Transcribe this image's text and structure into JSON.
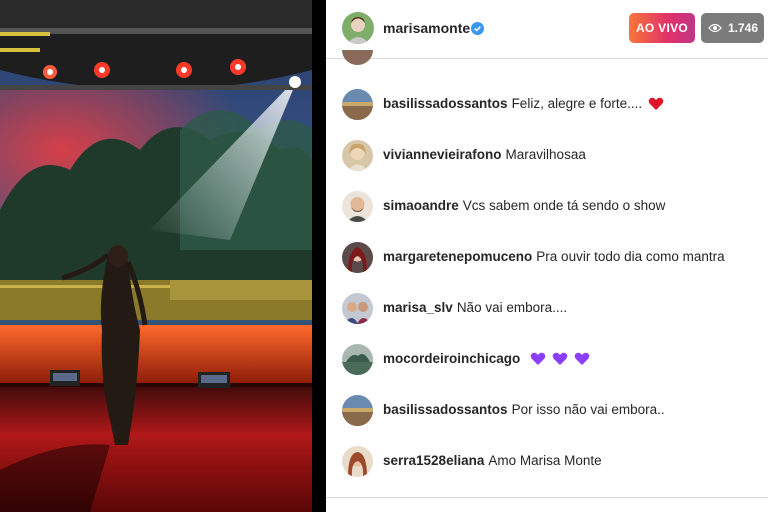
{
  "header": {
    "username": "marisamonte",
    "live_label": "AO VIVO",
    "viewer_count": "1.746"
  },
  "comments": [
    {
      "user": "basilissadossantos",
      "text": "Feliz, alegre e forte....",
      "emoji": "heart"
    },
    {
      "user": "viviannevieirafono",
      "text": "Maravilhosaa"
    },
    {
      "user": "simaoandre",
      "text": "Vcs sabem onde tá sendo o show"
    },
    {
      "user": "margaretenepomuceno",
      "text": "Pra ouvir todo dia como mantra"
    },
    {
      "user": "marisa_slv",
      "text": "Não vai embora...."
    },
    {
      "user": "mocordeiroinchicago",
      "text": "",
      "emoji": "purple-hearts"
    },
    {
      "user": "basilissadossantos",
      "text": "Por isso não vai embora.."
    },
    {
      "user": "serra1528eliana",
      "text": "Amo Marisa Monte"
    }
  ],
  "colors": {
    "live_gradient_start": "#f77737",
    "live_gradient_end": "#c13584",
    "viewer_badge": "#7b7b7b",
    "verified": "#3897f0",
    "heart_red": "#e0162b",
    "heart_purple": "#8a3ffc"
  },
  "icons": [
    "verified-icon",
    "eye-icon",
    "heart-icon",
    "purple-heart-icon"
  ]
}
